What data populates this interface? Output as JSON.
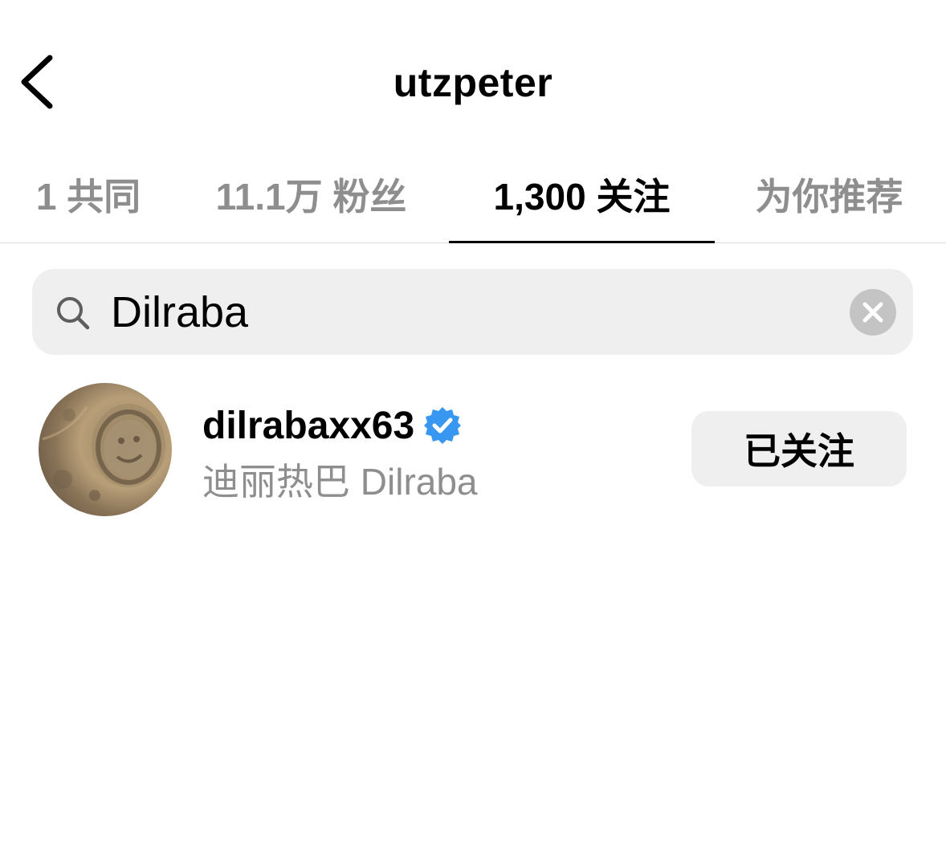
{
  "header": {
    "title": "utzpeter",
    "back_icon": "chevron-left-icon"
  },
  "tabs": [
    {
      "label": "1 共同",
      "active": false
    },
    {
      "label": "11.1万 粉丝",
      "active": false
    },
    {
      "label": "1,300 关注",
      "active": true
    },
    {
      "label": "为你推荐",
      "active": false
    }
  ],
  "search": {
    "value": "Dilraba",
    "placeholder": "",
    "search_icon": "search-icon",
    "clear_icon": "clear-icon"
  },
  "results": [
    {
      "username": "dilrabaxx63",
      "verified": true,
      "full_name": "迪丽热巴 Dilraba",
      "follow_button": "已关注"
    }
  ],
  "colors": {
    "secondary_text": "#8e8e8e",
    "search_bg": "#efefef",
    "verified_blue": "#3897f0",
    "clear_bg": "#c4c4c4"
  }
}
